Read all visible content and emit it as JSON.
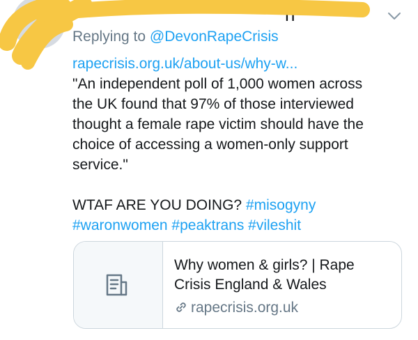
{
  "tweet": {
    "author_line_visible_fragment": "n",
    "replying_prefix": "Replying to",
    "replying_mention": "@DevonRapeCrisis",
    "link_text": "rapecrisis.org.uk/about-us/why-w...",
    "quote_lines": [
      "\"An independent poll of 1,000 women across",
      "the UK found that 97% of those interviewed",
      "thought a female rape victim should have the",
      "choice of accessing a women-only support",
      "service.\""
    ],
    "shout": "WTAF ARE YOU DOING?",
    "hashtags": [
      "#misogyny",
      "#waronwomen",
      "#peaktrans",
      "#vileshit"
    ]
  },
  "card": {
    "title": "Why women & girls? | Rape Crisis England & Wales",
    "domain": "rapecrisis.org.uk"
  },
  "icons": {
    "menu": "chevron-down-icon",
    "card_thumb": "document-icon",
    "card_link": "link-icon"
  },
  "colors": {
    "link_blue": "#1da1f2",
    "secondary_gray": "#657786",
    "card_border": "#ccd6dd",
    "redaction_yellow": "#f7c744"
  }
}
